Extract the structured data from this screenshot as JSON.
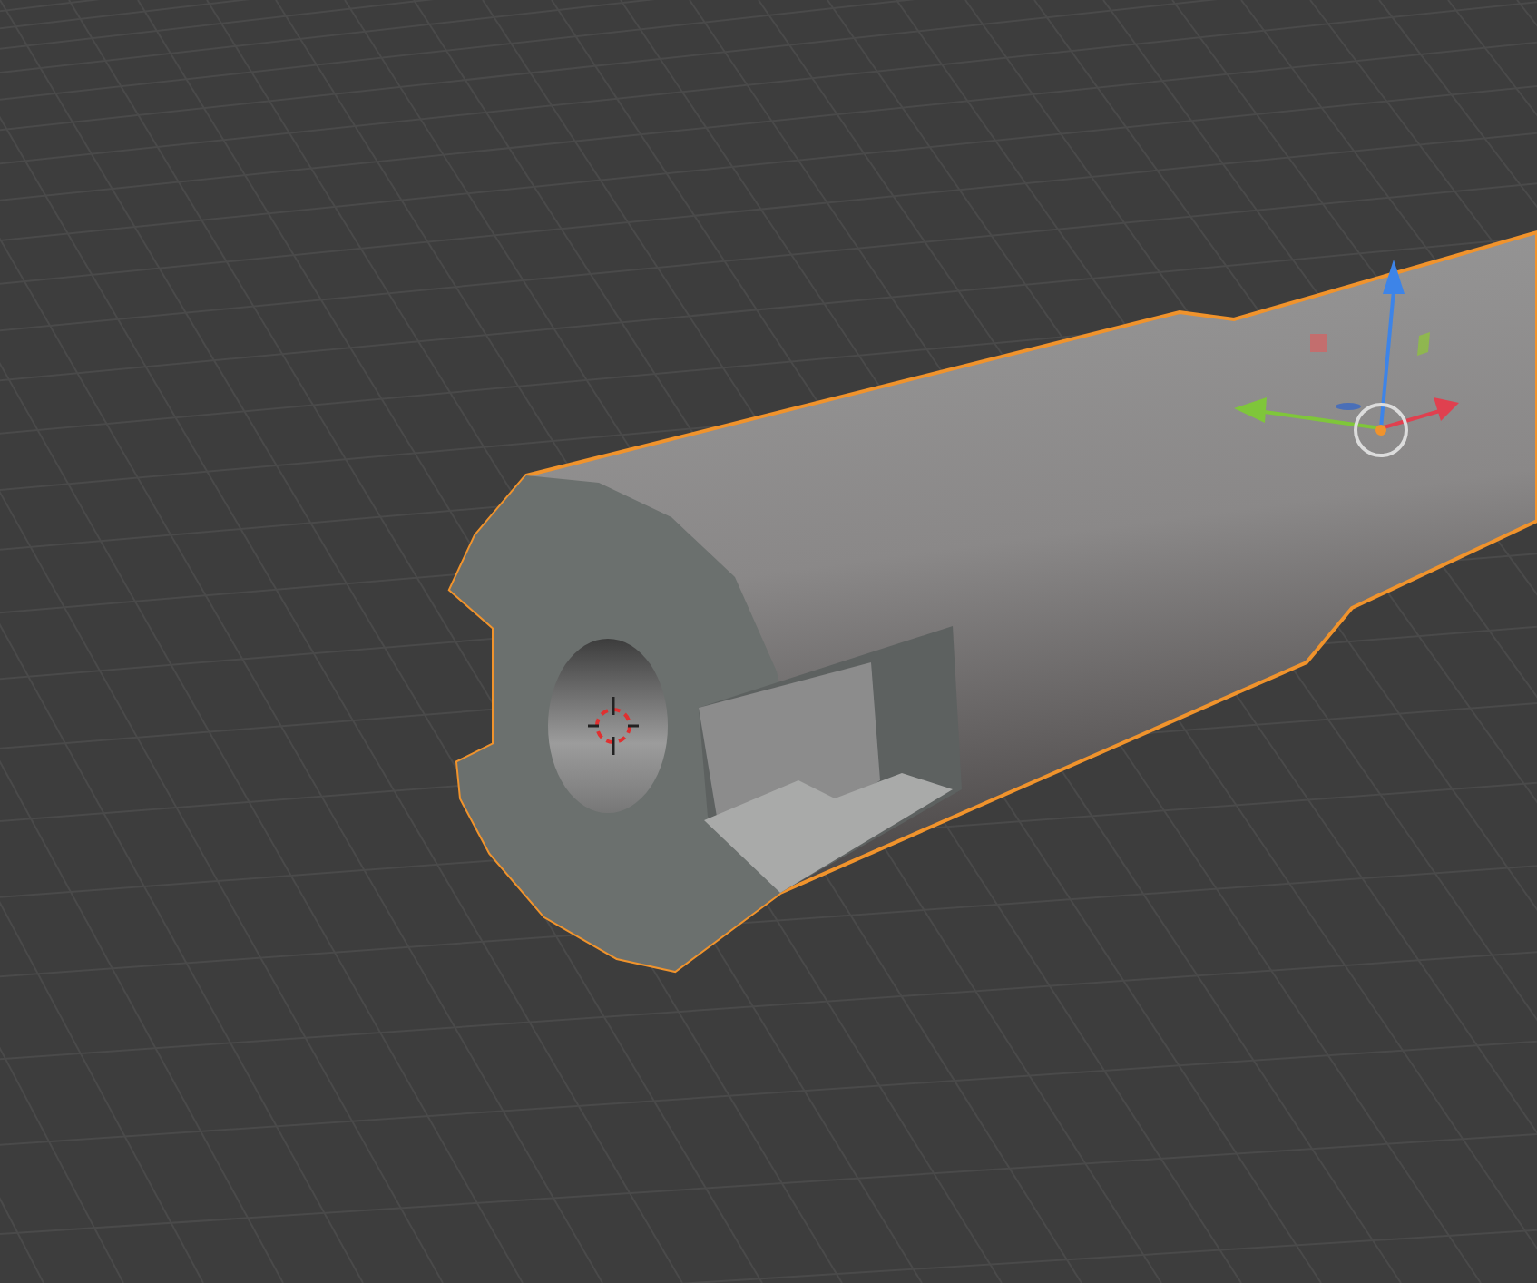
{
  "viewport": {
    "kind": "perspective",
    "object": {
      "selected": true
    }
  }
}
